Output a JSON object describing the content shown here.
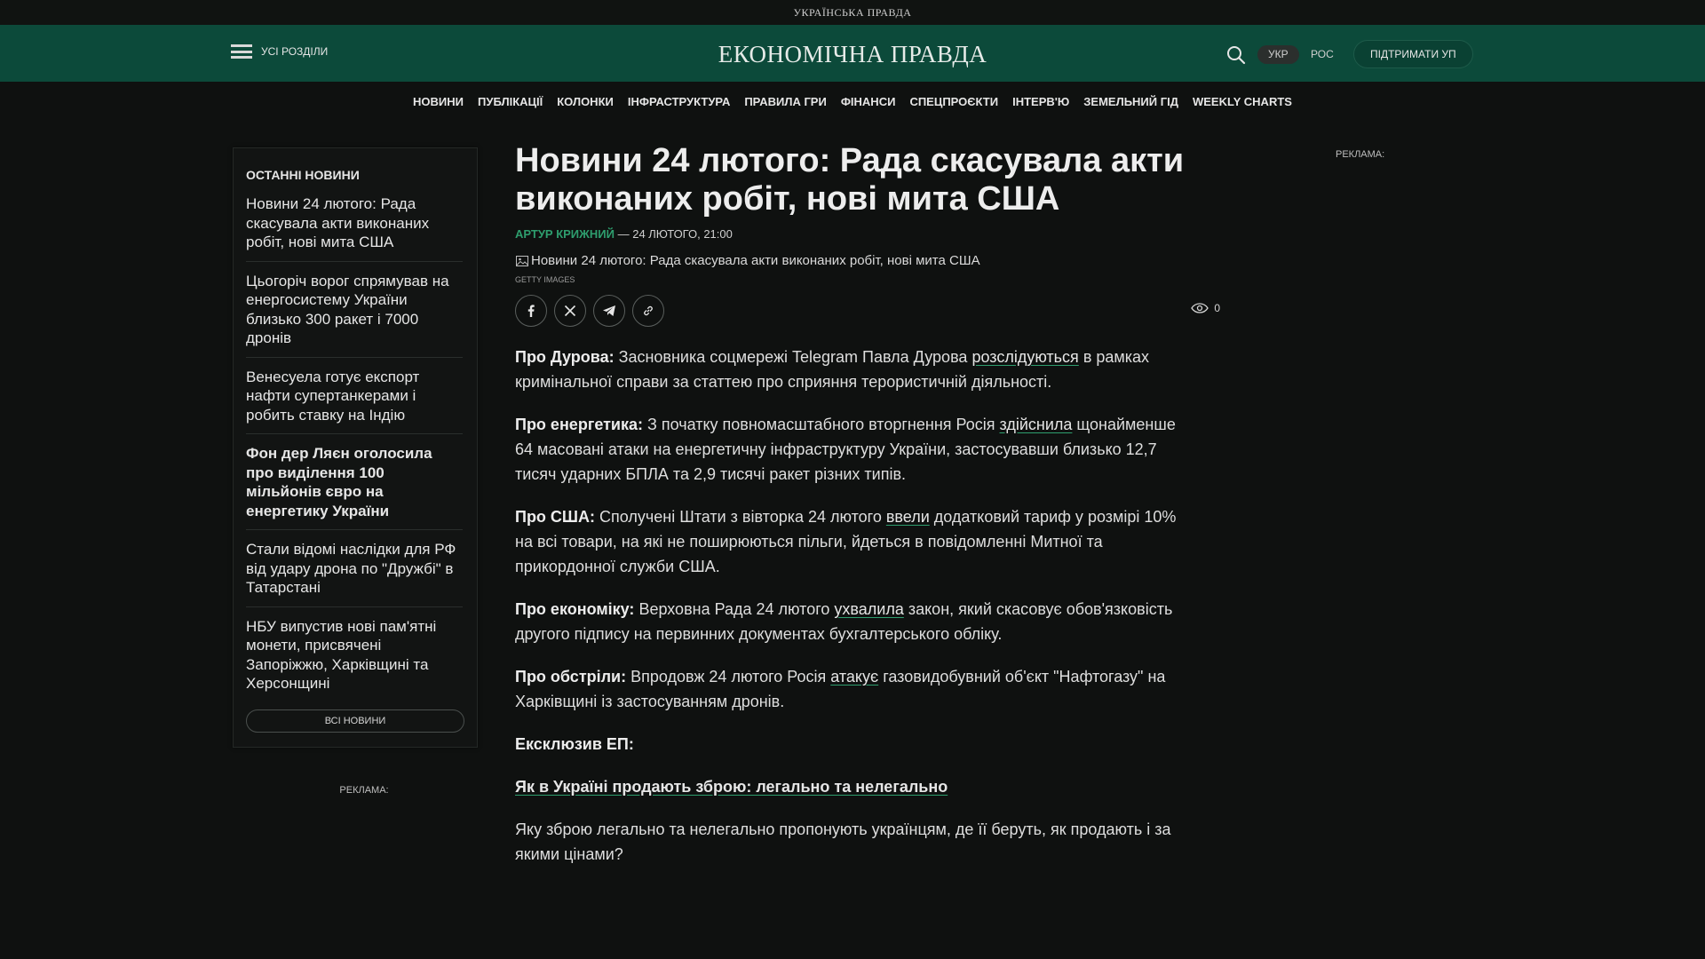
{
  "topbar": {
    "brand": "УКРАЇНСЬКА ПРАВДА"
  },
  "header": {
    "menu_label": "УСІ РОЗДІЛИ",
    "logo": "ЕКОНОМІЧНА ПРАВДА",
    "lang_active": "УКР",
    "lang_other": "РОС",
    "support_label": "ПІДТРИМАТИ УП",
    "accent_color": "#0c4a3a"
  },
  "nav": [
    "НОВИНИ",
    "ПУБЛІКАЦІЇ",
    "КОЛОНКИ",
    "ІНФРАСТРУКТУРА",
    "ПРАВИЛА ГРИ",
    "ФІНАНСИ",
    "СПЕЦПРОЄКТИ",
    "ІНТЕРВ'Ю",
    "ЗЕМЕЛЬНИЙ ГІД",
    "WEEKLY CHARTS"
  ],
  "sidebar": {
    "title": "ОСТАННІ НОВИНИ",
    "items": [
      "Новини 24 лютого: Рада скасувала акти виконаних робіт, нові мита США",
      "Цьогоріч ворог спрямував на енергосистему України близько 300 ракет і 7000 дронів",
      "Венесуела готує експорт нафти супертанкерами і робить ставку на Індію",
      "Фон дер Ляєн оголосила про виділення 100 мільйонів євро на енергетику України",
      "Стали відомі наслідки для РФ від удару дрона по \"Дружбі\" в Татарстані",
      "НБУ випустив нові пам'ятні монети, присвячені Запоріжжю, Харківщині та Херсонщині"
    ],
    "all_news_label": "ВСІ НОВИНИ",
    "ad_label": "РЕКЛАМА:"
  },
  "ad_right_label": "РЕКЛАМА:",
  "article": {
    "title": "Новини 24 лютого: Рада скасувала акти виконаних робіт, нові мита США",
    "author": "АРТУР КРИЖНИЙ",
    "date": " — 24 ЛЮТОГО, 21:00",
    "image_alt": "Новини 24 лютого: Рада скасувала акти виконаних робіт, нові мита США",
    "image_credit": "GETTY IMAGES",
    "views": "0",
    "brand_green": "#2e9e6e",
    "paragraphs": {
      "p1": {
        "label": "Про Дурова:",
        "before": " Засновника соцмережі Telegram Павла Дурова ",
        "link": "розслідуються",
        "after": " в рамках кримінальної справи за статтею про сприяння терористичній діяльності."
      },
      "p2": {
        "label": "Про енергетика:",
        "before": " З початку повномасштабного вторгнення Росія ",
        "link": "здійснила",
        "after": " щонайменше 64 масовані атаки на енергетичну інфраструктуру України, застосувавши близько 12,7 тисяч ударних БПЛА та 2,9 тисячі ракет різних типів."
      },
      "p3": {
        "label": "Про США:",
        "before": " Сполучені Штати з вівторка 24 лютого ",
        "link": "ввели",
        "after": " додатковий тариф у розмірі 10% на всі товари, на які не поширюються пільги, йдеться в повідомленні Митної та прикордонної служби США."
      },
      "p4": {
        "label": "Про економіку:",
        "before": " Верховна Рада 24 лютого ",
        "link": "ухвалила",
        "after": " закон, який скасовує обов'язковість другого підпису на первинних документах бухгалтерського обліку."
      },
      "p5": {
        "label": "Про обстріли:",
        "before": " Впродовж 24 лютого Росія ",
        "link": "атакує",
        "after": " газовидобувний об'єкт \"Нафтогазу\" на Харківщині із застосуванням дронів."
      },
      "exclusive_label": "Ексклюзив ЕП:",
      "exclusive_link": "Як в Україні продають зброю: легально та нелегально",
      "exclusive_text": "Яку зброю легально та нелегально пропонують українцям, де її беруть, як продають і за якими цінами?"
    }
  }
}
